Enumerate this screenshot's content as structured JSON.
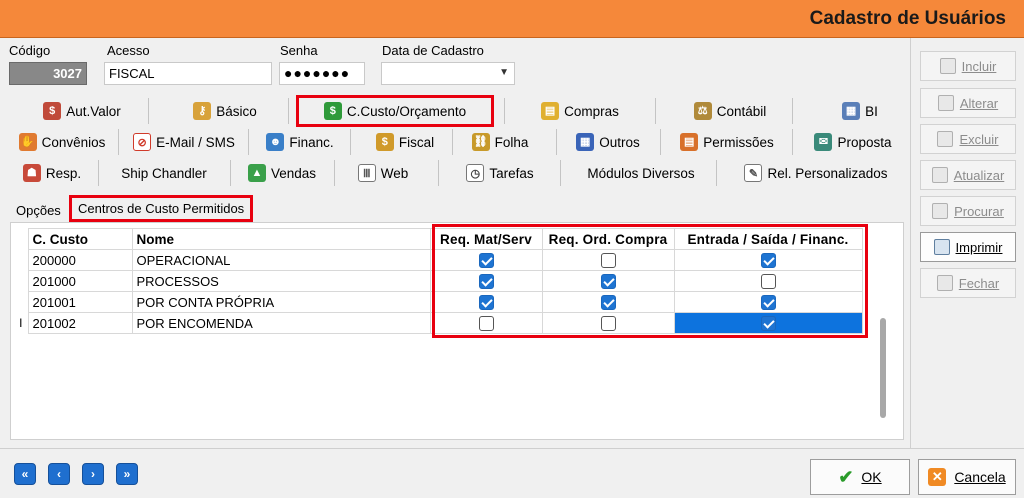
{
  "window": {
    "title": "Cadastro de Usuários"
  },
  "form": {
    "codigo_label": "Código",
    "codigo_value": "3027",
    "acesso_label": "Acesso",
    "acesso_value": "FISCAL",
    "senha_label": "Senha",
    "senha_value": "●●●●●●●",
    "data_label": "Data de Cadastro",
    "data_value": ""
  },
  "tabs": {
    "row1": [
      "Aut.Valor",
      "Básico",
      "C.Custo/Orçamento",
      "Compras",
      "Contábil",
      "BI"
    ],
    "row2": [
      "Convênios",
      "E-Mail / SMS",
      "Financ.",
      "Fiscal",
      "Folha",
      "Outros",
      "Permissões",
      "Proposta"
    ],
    "row3": [
      "Resp.",
      "Ship Chandler",
      "Vendas",
      "Web",
      "Tarefas",
      "Módulos Diversos",
      "Rel. Personalizados"
    ],
    "active": "C.Custo/Orçamento"
  },
  "subtabs": [
    "Opções",
    "Centros de Custo Permitidos"
  ],
  "grid": {
    "headers": [
      "C. Custo",
      "Nome",
      "Req. Mat/Serv",
      "Req. Ord. Compra",
      "Entrada / Saída / Financ."
    ],
    "rows": [
      {
        "code": "200000",
        "name": "OPERACIONAL",
        "req_mat": true,
        "req_ord": false,
        "entrada": true
      },
      {
        "code": "201000",
        "name": "PROCESSOS",
        "req_mat": true,
        "req_ord": true,
        "entrada": false
      },
      {
        "code": "201001",
        "name": "POR CONTA PRÓPRIA",
        "req_mat": true,
        "req_ord": true,
        "entrada": true
      },
      {
        "code": "201002",
        "name": "POR ENCOMENDA",
        "req_mat": false,
        "req_ord": false,
        "entrada": true
      }
    ],
    "cursor_glyph": "I"
  },
  "actions": {
    "incluir": "Incluir",
    "alterar": "Alterar",
    "excluir": "Excluir",
    "atualizar": "Atualizar",
    "procurar": "Procurar",
    "imprimir": "Imprimir",
    "fechar": "Fechar"
  },
  "footer": {
    "ok": "OK",
    "cancel": "Cancela"
  },
  "colors": {
    "titlebar": "#f5883a",
    "highlight": "#e8000f",
    "checkbox": "#1e74d2",
    "selection": "#0d73de"
  }
}
